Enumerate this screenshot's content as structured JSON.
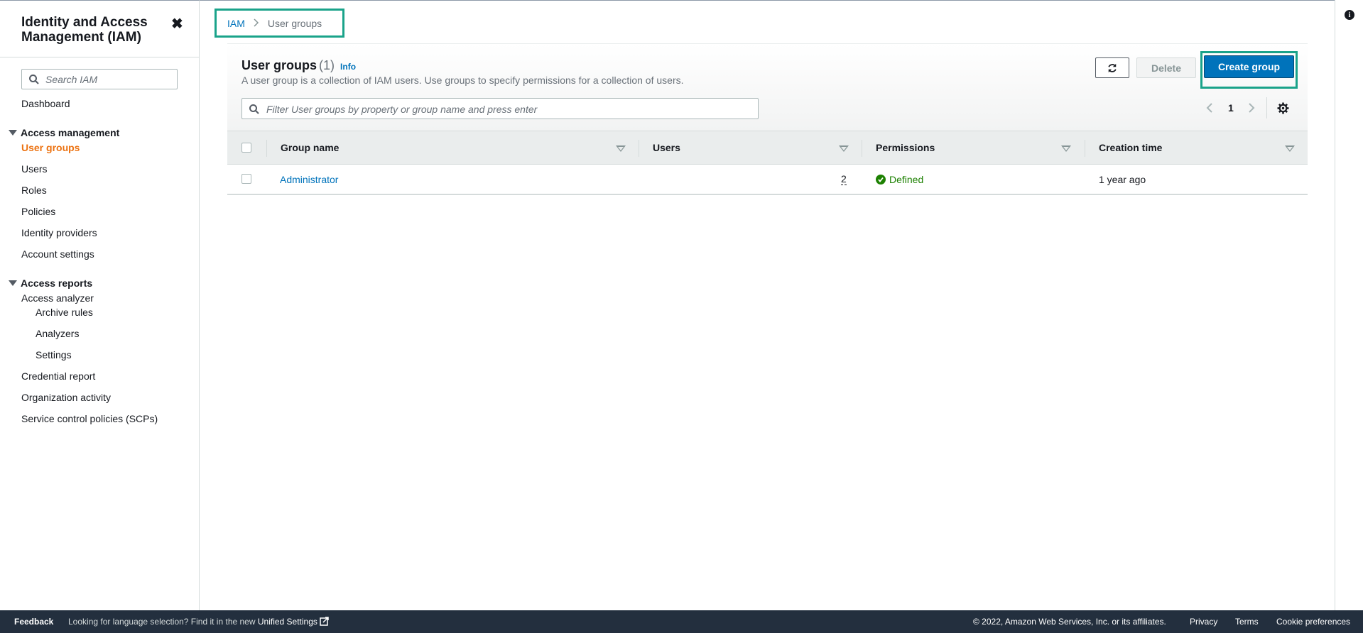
{
  "sidebar": {
    "title": "Identity and Access Management (IAM)",
    "close_glyph": "✖",
    "search_placeholder": "Search IAM",
    "dashboard": "Dashboard",
    "access_management": {
      "heading": "Access management",
      "items": [
        "User groups",
        "Users",
        "Roles",
        "Policies",
        "Identity providers",
        "Account settings"
      ],
      "active": "User groups"
    },
    "access_reports": {
      "heading": "Access reports",
      "analyzer": "Access analyzer",
      "analyzer_children": [
        "Archive rules",
        "Analyzers",
        "Settings"
      ],
      "items": [
        "Credential report",
        "Organization activity",
        "Service control policies (SCPs)"
      ]
    }
  },
  "breadcrumb": {
    "root": "IAM",
    "separator": ">",
    "current": "User groups"
  },
  "header": {
    "title": "User groups",
    "count": "(1)",
    "info": "Info",
    "description": "A user group is a collection of IAM users. Use groups to specify permissions for a collection of users.",
    "delete_label": "Delete",
    "create_label": "Create group"
  },
  "filter": {
    "placeholder": "Filter User groups by property or group name and press enter"
  },
  "pagination": {
    "current_page": "1"
  },
  "table": {
    "columns": [
      "Group name",
      "Users",
      "Permissions",
      "Creation time"
    ],
    "rows": [
      {
        "group_name": "Administrator",
        "users": "2",
        "permissions": "Defined",
        "creation_time": "1 year ago"
      }
    ]
  },
  "footer": {
    "feedback": "Feedback",
    "language_text": "Looking for language selection? Find it in the new",
    "unified_settings": "Unified Settings",
    "copyright": "© 2022, Amazon Web Services, Inc. or its affiliates.",
    "privacy": "Privacy",
    "terms": "Terms",
    "cookies": "Cookie preferences"
  },
  "colors": {
    "accent_active": "#ec7211",
    "link": "#0073bb",
    "primary_button": "#0073bb",
    "success": "#1d8102",
    "highlight_box": "#1aa38a",
    "footer_bg": "#232f3e"
  },
  "icons": {
    "search": "search-icon",
    "refresh": "refresh-icon",
    "settings": "gear-icon",
    "info": "info-icon",
    "external": "external-link-icon",
    "success": "check-circle-icon"
  }
}
